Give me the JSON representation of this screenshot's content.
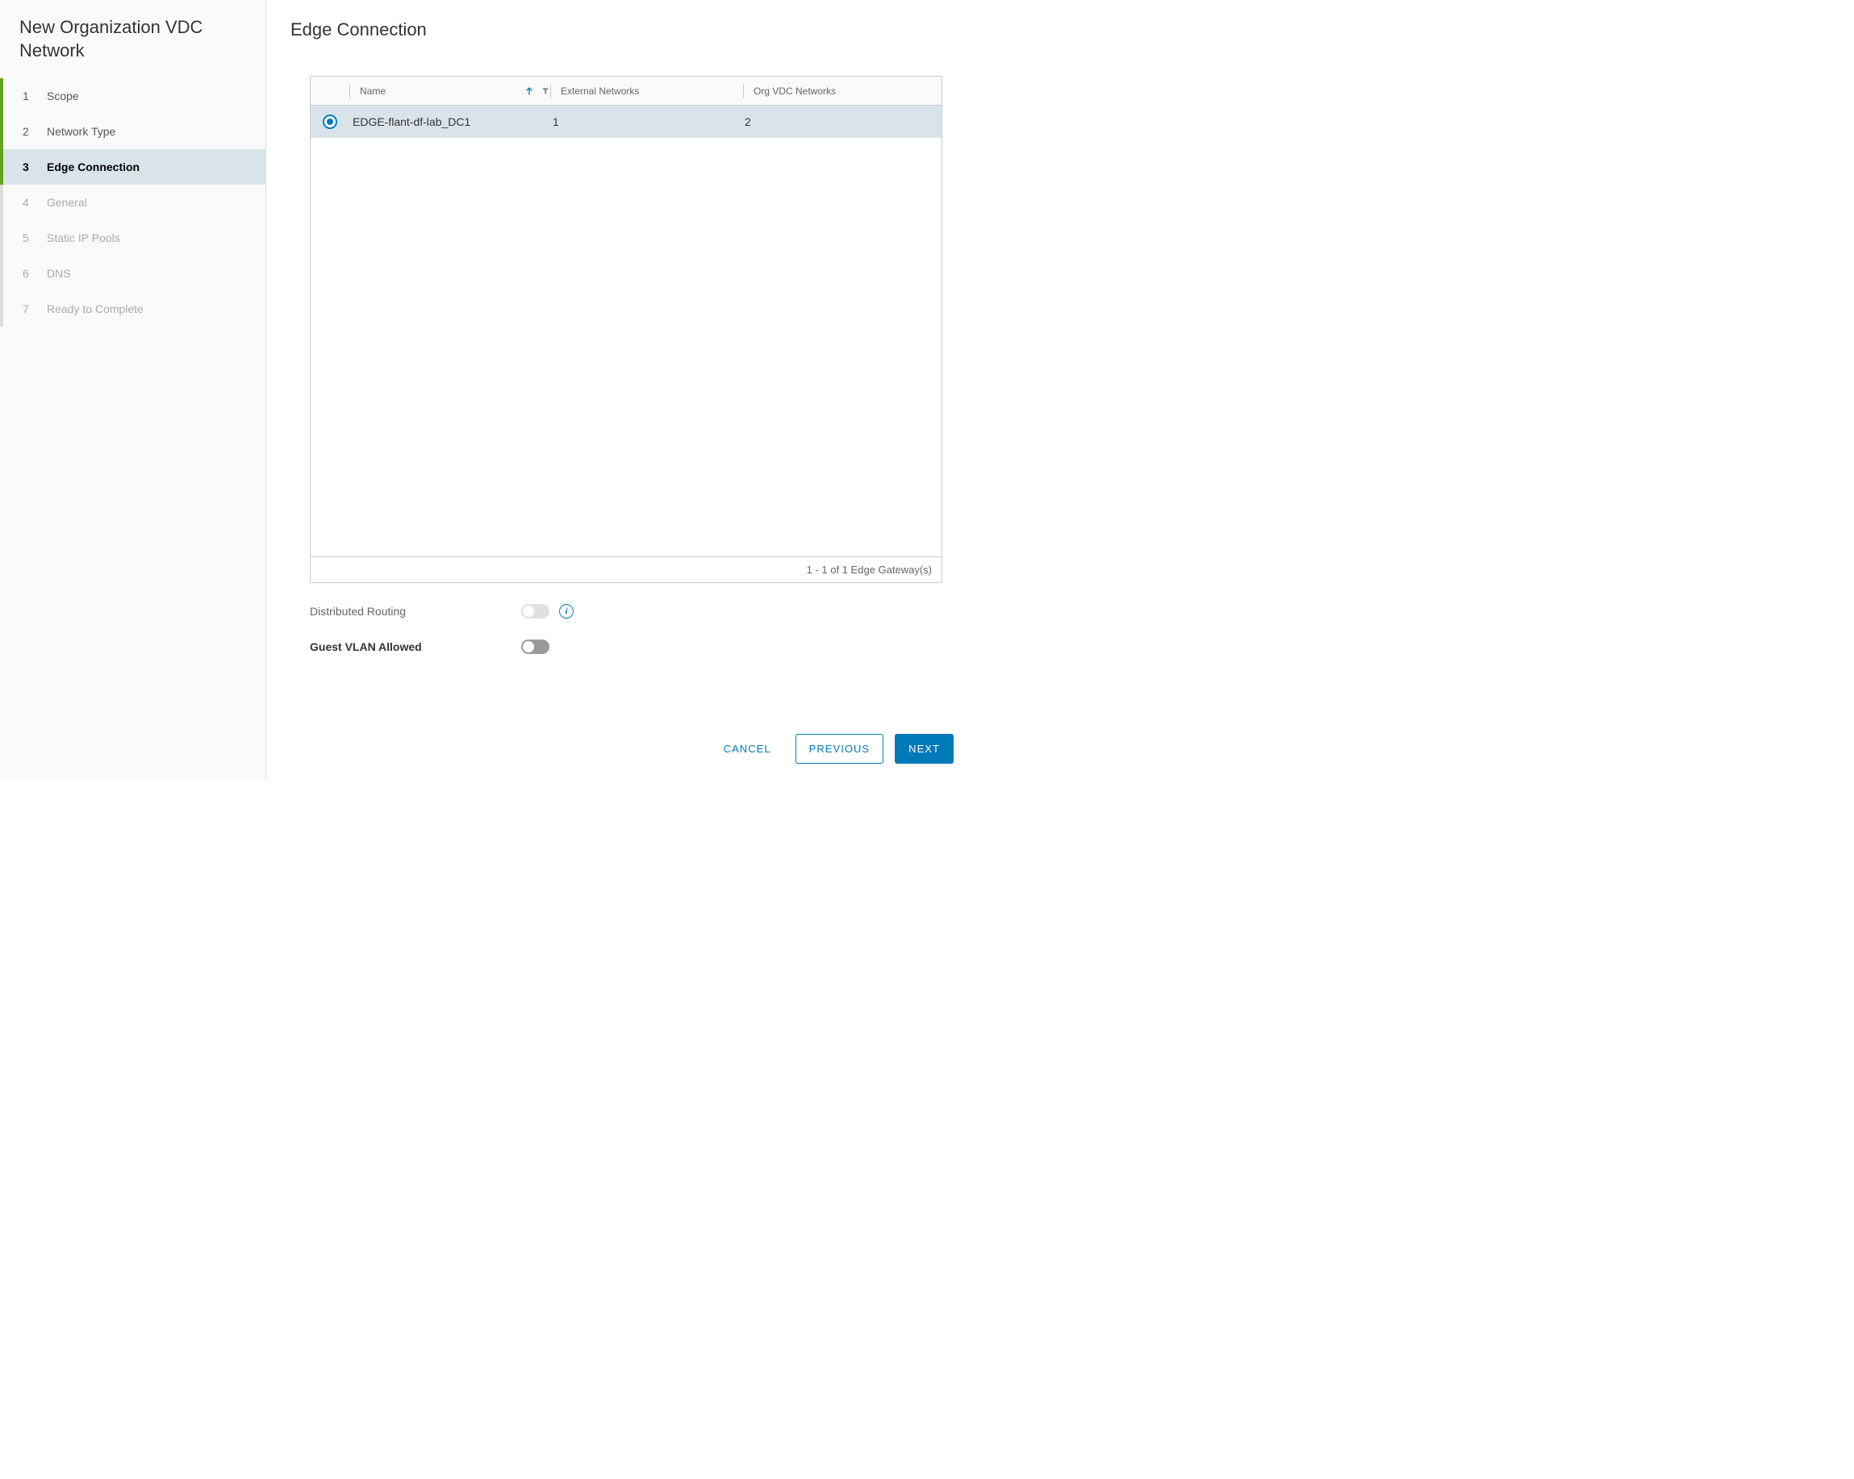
{
  "sidebar": {
    "title": "New Organization VDC Network",
    "steps": [
      {
        "num": "1",
        "label": "Scope",
        "state": "completed"
      },
      {
        "num": "2",
        "label": "Network Type",
        "state": "completed"
      },
      {
        "num": "3",
        "label": "Edge Connection",
        "state": "active"
      },
      {
        "num": "4",
        "label": "General",
        "state": "future"
      },
      {
        "num": "5",
        "label": "Static IP Pools",
        "state": "future"
      },
      {
        "num": "6",
        "label": "DNS",
        "state": "future"
      },
      {
        "num": "7",
        "label": "Ready to Complete",
        "state": "future"
      }
    ]
  },
  "page": {
    "title": "Edge Connection"
  },
  "table": {
    "columns": {
      "name": "Name",
      "external": "External Networks",
      "org": "Org VDC Networks"
    },
    "rows": [
      {
        "name": "EDGE-flant-df-lab_DC1",
        "external": "1",
        "org": "2"
      }
    ],
    "footer": "1 - 1 of 1 Edge Gateway(s)"
  },
  "options": {
    "distributed_routing_label": "Distributed Routing",
    "guest_vlan_label": "Guest VLAN Allowed"
  },
  "buttons": {
    "cancel": "CANCEL",
    "previous": "PREVIOUS",
    "next": "NEXT"
  }
}
